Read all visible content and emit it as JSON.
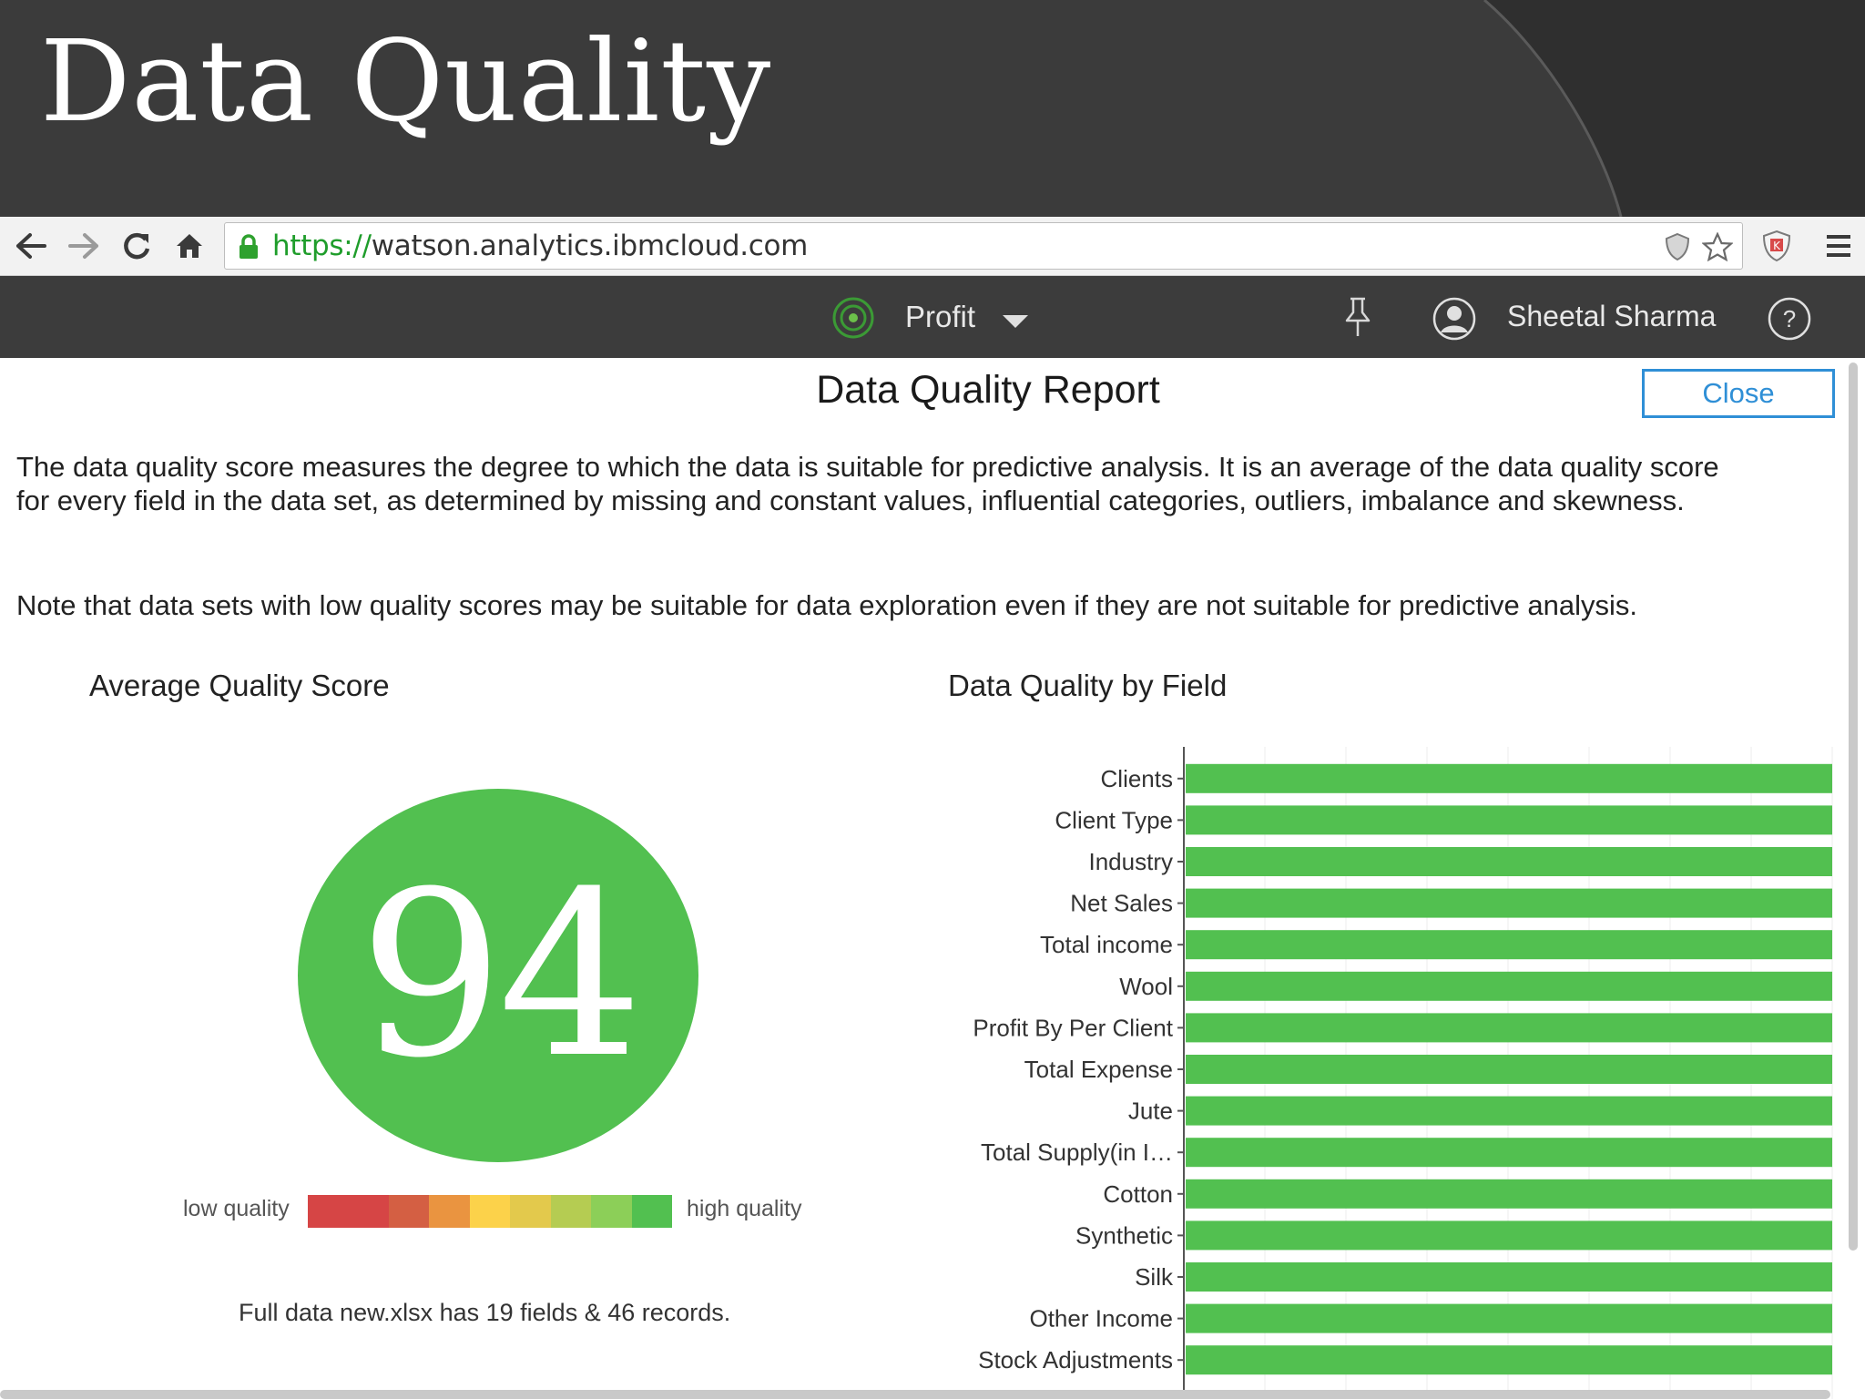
{
  "slide": {
    "title": "Data Quality"
  },
  "browser": {
    "url_scheme": "https://",
    "url_rest": "watson.analytics.ibmcloud.com",
    "icons": [
      "back-arrow-icon",
      "forward-arrow-icon",
      "reload-icon",
      "home-icon",
      "lock-icon",
      "shield-icon",
      "star-icon",
      "extension-icon",
      "menu-icon"
    ]
  },
  "app_header": {
    "app_name": "Profit",
    "user_name": "Sheetal Sharma",
    "help_label": "?"
  },
  "report": {
    "title": "Data Quality Report",
    "close_label": "Close",
    "description_line1": "The data quality score measures the degree to which the data is suitable for predictive analysis. It is an average of the data quality score",
    "description_line2": "for every field in the data set, as determined by missing and constant values, influential categories, outliers, imbalance and skewness.",
    "note": "Note that data sets with low quality scores may be suitable for data exploration even if they are not suitable for predictive analysis."
  },
  "average_score": {
    "title": "Average Quality Score",
    "value": "94",
    "color": "#52c050",
    "legend_low": "low quality",
    "legend_high": "high quality",
    "legend_colors": [
      "#d64545",
      "#d64545",
      "#d45f43",
      "#ea9440",
      "#fcd24a",
      "#e3c94c",
      "#b5cc52",
      "#8ccf58",
      "#52c050"
    ],
    "dataset_info": "Full data new.xlsx has 19 fields & 46 records."
  },
  "chart_data": {
    "type": "bar",
    "orientation": "horizontal",
    "title": "Data Quality by Field",
    "categories": [
      "Clients",
      "Client Type",
      "Industry",
      "Net Sales",
      "Total income",
      "Wool",
      "Profit By Per Client",
      "Total Expense",
      "Jute",
      "Total Supply(in I…",
      "Cotton",
      "Synthetic",
      "Silk",
      "Other Income",
      "Stock Adjustments"
    ],
    "values": [
      100,
      100,
      100,
      100,
      100,
      100,
      100,
      100,
      100,
      100,
      100,
      100,
      100,
      100,
      100
    ],
    "xlim": [
      0,
      100
    ],
    "bar_color": "#52c050",
    "grid": true
  }
}
